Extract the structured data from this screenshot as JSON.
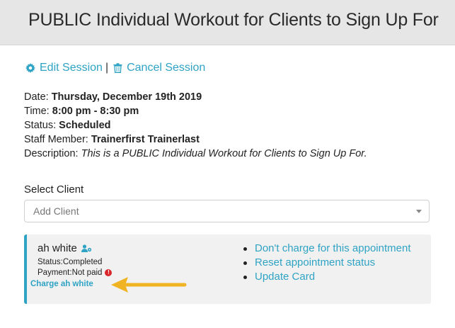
{
  "header": {
    "title": "PUBLIC Individual Workout for Clients to Sign Up For"
  },
  "actions": {
    "edit_label": "Edit Session",
    "separator": "|",
    "cancel_label": "Cancel Session"
  },
  "details": {
    "date_label": "Date: ",
    "date_value": "Thursday, December 19th 2019",
    "time_label": "Time: ",
    "time_value": "8:00 pm - 8:30 pm",
    "status_label": "Status: ",
    "status_value": "Scheduled",
    "staff_label": "Staff Member: ",
    "staff_value": "Trainerfirst Trainerlast",
    "description_label": "Description: ",
    "description_value": "This is a PUBLIC Individual Workout for Clients to Sign Up For."
  },
  "select_client": {
    "label": "Select Client",
    "placeholder": "Add Client"
  },
  "client": {
    "name": "ah white",
    "status_label": "Status: ",
    "status_value": "Completed",
    "payment_label": "Payment: ",
    "payment_value": "Not paid",
    "alert_glyph": "!",
    "charge_link": "Charge ah white",
    "options": [
      "Don't charge for this appointment",
      "Reset appointment status",
      "Update Card"
    ]
  },
  "colors": {
    "accent": "#2fa3c4",
    "header_bg": "#e6e6e6",
    "alert": "#d9262b",
    "arrow": "#f0b323"
  }
}
